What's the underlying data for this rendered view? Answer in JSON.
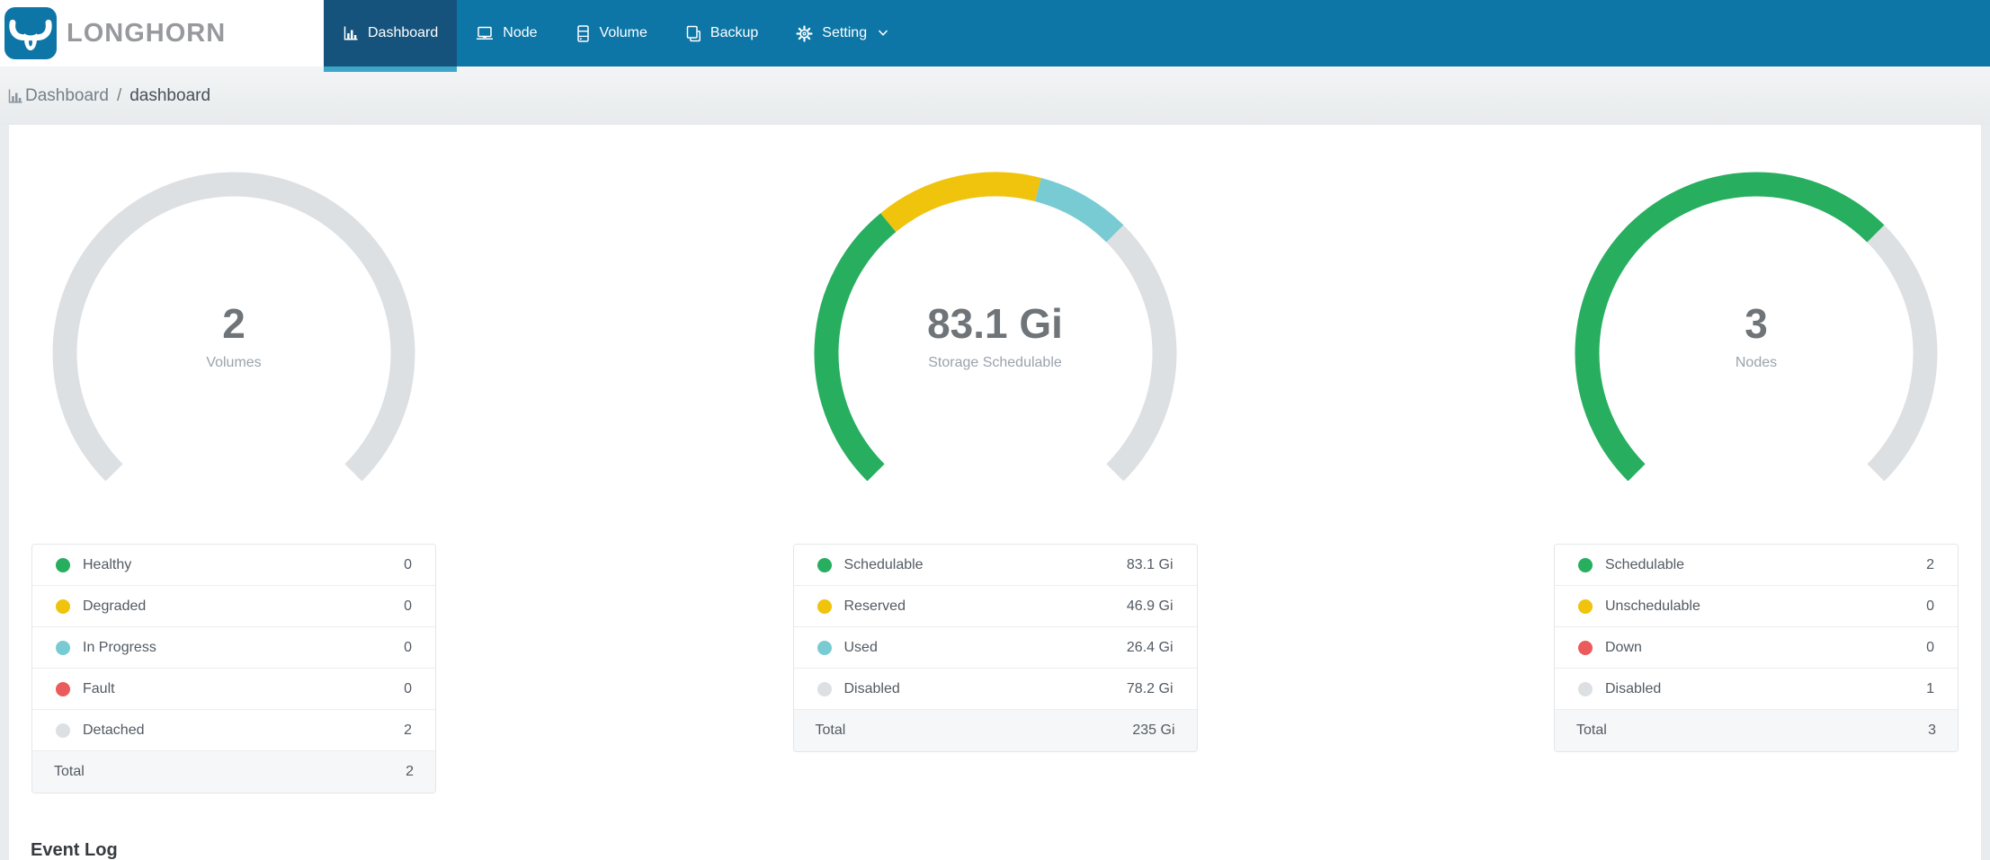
{
  "brand": {
    "name": "LONGHORN",
    "logo": "longhorn-bull-logo"
  },
  "nav": {
    "items": [
      {
        "label": "Dashboard",
        "icon": "bar-chart-icon",
        "active": true,
        "has_dropdown": false
      },
      {
        "label": "Node",
        "icon": "laptop-icon",
        "active": false,
        "has_dropdown": false
      },
      {
        "label": "Volume",
        "icon": "server-icon",
        "active": false,
        "has_dropdown": false
      },
      {
        "label": "Backup",
        "icon": "copy-icon",
        "active": false,
        "has_dropdown": false
      },
      {
        "label": "Setting",
        "icon": "gear-icon",
        "active": false,
        "has_dropdown": true
      }
    ]
  },
  "breadcrumb": {
    "icon": "bar-chart-icon",
    "root": "Dashboard",
    "separator": "/",
    "current": "dashboard"
  },
  "event_log": {
    "title": "Event Log"
  },
  "colors": {
    "green": "#27ae5f",
    "yellow": "#f0c30c",
    "teal": "#79cbd3",
    "red": "#ec5b5c",
    "gray": "#dde0e3",
    "header_blue": "#0d76a6",
    "active_tab_blue": "#15537c",
    "active_tab_underline": "#3ba6c9"
  },
  "chart_data": [
    {
      "type": "gauge",
      "title": "Volumes",
      "arc_degrees": 270,
      "center_value": "2",
      "center_label": "Volumes",
      "segments": [
        {
          "label": "Healthy",
          "value": 0,
          "display": "0",
          "color_key": "green"
        },
        {
          "label": "Degraded",
          "value": 0,
          "display": "0",
          "color_key": "yellow"
        },
        {
          "label": "In Progress",
          "value": 0,
          "display": "0",
          "color_key": "teal"
        },
        {
          "label": "Fault",
          "value": 0,
          "display": "0",
          "color_key": "red"
        },
        {
          "label": "Detached",
          "value": 2,
          "display": "2",
          "color_key": "gray"
        }
      ],
      "total": {
        "label": "Total",
        "value": 2,
        "display": "2"
      }
    },
    {
      "type": "gauge",
      "title": "Storage Schedulable",
      "arc_degrees": 270,
      "center_value": "83.1 Gi",
      "center_label": "Storage Schedulable",
      "segments": [
        {
          "label": "Schedulable",
          "value": 83.1,
          "display": "83.1 Gi",
          "color_key": "green"
        },
        {
          "label": "Reserved",
          "value": 46.9,
          "display": "46.9 Gi",
          "color_key": "yellow"
        },
        {
          "label": "Used",
          "value": 26.4,
          "display": "26.4 Gi",
          "color_key": "teal"
        },
        {
          "label": "Disabled",
          "value": 78.2,
          "display": "78.2 Gi",
          "color_key": "gray"
        }
      ],
      "total": {
        "label": "Total",
        "value": 235,
        "display": "235 Gi"
      }
    },
    {
      "type": "gauge",
      "title": "Nodes",
      "arc_degrees": 270,
      "center_value": "3",
      "center_label": "Nodes",
      "segments": [
        {
          "label": "Schedulable",
          "value": 2,
          "display": "2",
          "color_key": "green"
        },
        {
          "label": "Unschedulable",
          "value": 0,
          "display": "0",
          "color_key": "yellow"
        },
        {
          "label": "Down",
          "value": 0,
          "display": "0",
          "color_key": "red"
        },
        {
          "label": "Disabled",
          "value": 1,
          "display": "1",
          "color_key": "gray"
        }
      ],
      "total": {
        "label": "Total",
        "value": 3,
        "display": "3"
      }
    }
  ]
}
